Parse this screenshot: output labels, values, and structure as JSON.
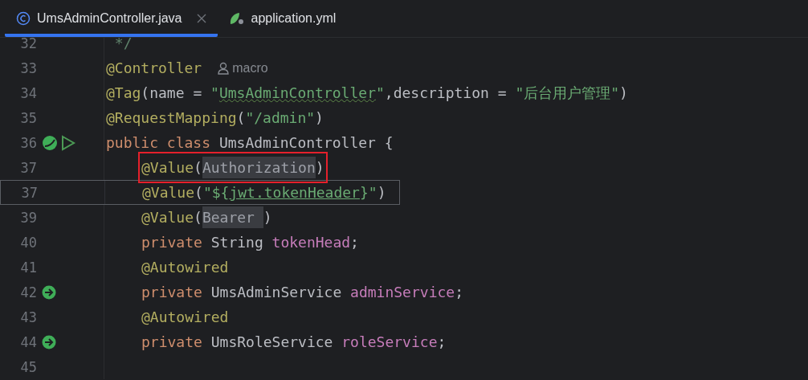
{
  "tabs": [
    {
      "label": "UmsAdminController.java",
      "kind": "java",
      "selected": true,
      "closable": true
    },
    {
      "label": "application.yml",
      "kind": "yaml",
      "selected": false
    }
  ],
  "lines": [
    {
      "number": "32",
      "kind": "code",
      "indented": false,
      "tokens": [
        {
          "kind": "doc",
          "text": " */"
        }
      ]
    },
    {
      "number": "33",
      "kind": "code",
      "indented": false,
      "author_hint": "macro",
      "tokens": [
        {
          "kind": "annotation",
          "text": "@Controller"
        }
      ]
    },
    {
      "number": "34",
      "kind": "code",
      "indented": false,
      "tokens": [
        {
          "kind": "annotation",
          "text": "@Tag"
        },
        {
          "kind": "plain",
          "text": "(name = "
        },
        {
          "kind": "string",
          "text": "\""
        },
        {
          "kind": "squiggle",
          "text": "UmsAdminController"
        },
        {
          "kind": "string",
          "text": "\""
        },
        {
          "kind": "plain",
          "text": ",description = "
        },
        {
          "kind": "string",
          "text": "\"后台用户管理\""
        },
        {
          "kind": "plain",
          "text": ")"
        }
      ]
    },
    {
      "number": "35",
      "kind": "code",
      "indented": false,
      "tokens": [
        {
          "kind": "annotation",
          "text": "@RequestMapping"
        },
        {
          "kind": "plain",
          "text": "("
        },
        {
          "kind": "string",
          "text": "\"/admin\""
        },
        {
          "kind": "plain",
          "text": ")"
        }
      ]
    },
    {
      "number": "36",
      "kind": "code",
      "indented": false,
      "bean_marker": true,
      "run_marker": true,
      "tokens": [
        {
          "kind": "keyword",
          "text": "public class "
        },
        {
          "kind": "plain",
          "text": "UmsAdminController {"
        }
      ]
    },
    {
      "number": "37",
      "kind": "code",
      "indented": true,
      "outlined": true,
      "tokens": [
        {
          "kind": "annotation",
          "text": "@Value"
        },
        {
          "kind": "plain",
          "text": "("
        },
        {
          "kind": "folded",
          "text": "Authorization"
        },
        {
          "kind": "plain",
          "text": ")"
        }
      ]
    },
    {
      "number": "37",
      "kind": "popup",
      "indented": true,
      "tokens": [
        {
          "kind": "annotation",
          "text": "@Value"
        },
        {
          "kind": "plain",
          "text": "("
        },
        {
          "kind": "string",
          "text": "\"${"
        },
        {
          "kind": "link",
          "text": "jwt.tokenHeader"
        },
        {
          "kind": "string",
          "text": "}\""
        },
        {
          "kind": "plain",
          "text": ")"
        }
      ]
    },
    {
      "number": "39",
      "kind": "code",
      "indented": true,
      "tokens": [
        {
          "kind": "annotation",
          "text": "@Value"
        },
        {
          "kind": "plain",
          "text": "("
        },
        {
          "kind": "folded",
          "text": "Bearer "
        },
        {
          "kind": "plain",
          "text": ")"
        }
      ]
    },
    {
      "number": "40",
      "kind": "code",
      "indented": true,
      "tokens": [
        {
          "kind": "keyword",
          "text": "private "
        },
        {
          "kind": "plain",
          "text": "String "
        },
        {
          "kind": "field",
          "text": "tokenHead"
        },
        {
          "kind": "plain",
          "text": ";"
        }
      ]
    },
    {
      "number": "41",
      "kind": "code",
      "indented": true,
      "tokens": [
        {
          "kind": "annotation",
          "text": "@Autowired"
        }
      ]
    },
    {
      "number": "42",
      "kind": "code",
      "indented": true,
      "inject_marker": true,
      "tokens": [
        {
          "kind": "keyword",
          "text": "private "
        },
        {
          "kind": "plain",
          "text": "UmsAdminService "
        },
        {
          "kind": "field",
          "text": "adminService"
        },
        {
          "kind": "plain",
          "text": ";"
        }
      ]
    },
    {
      "number": "43",
      "kind": "code",
      "indented": true,
      "tokens": [
        {
          "kind": "annotation",
          "text": "@Autowired"
        }
      ]
    },
    {
      "number": "44",
      "kind": "code",
      "indented": true,
      "inject_marker": true,
      "tokens": [
        {
          "kind": "keyword",
          "text": "private "
        },
        {
          "kind": "plain",
          "text": "UmsRoleService "
        },
        {
          "kind": "field",
          "text": "roleService"
        },
        {
          "kind": "plain",
          "text": ";"
        }
      ]
    },
    {
      "number": "45",
      "kind": "code",
      "indented": false
    }
  ]
}
